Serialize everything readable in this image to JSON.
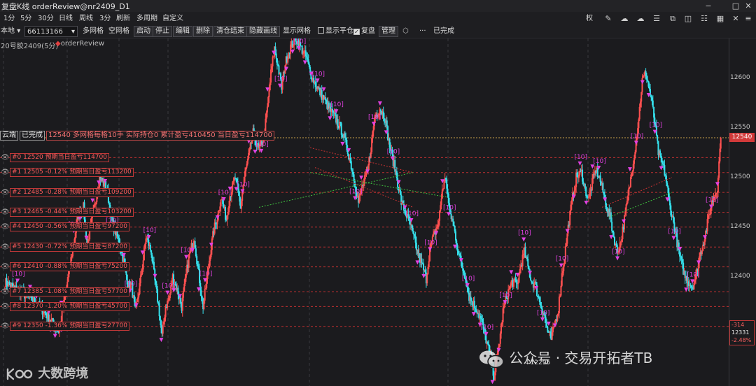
{
  "window": {
    "title": "复盘K线 orderReview@nr2409_D1",
    "controls": [
      "restore-down",
      "maximize",
      "close"
    ]
  },
  "toolbar1": {
    "periods": [
      "1分",
      "5分",
      "30分",
      "日线",
      "周线",
      "3分"
    ],
    "actions": [
      "刷新",
      "多周期",
      "自定义"
    ],
    "right_label": "权"
  },
  "toolbar2": {
    "source": "本地",
    "account": "66113166",
    "buttons_a": [
      "多网格",
      "空网格"
    ],
    "buttons_b": [
      "启动",
      "停止",
      "编辑",
      "删除",
      "清仓结束",
      "隐藏画线"
    ],
    "show_grid": "显示网格",
    "show_flat": "显示平仓",
    "show_flat_checked": false,
    "review": "复盘",
    "review_checked": true,
    "manage": "管理",
    "more": "···",
    "done": "已完成"
  },
  "chart_header": {
    "symbol": "20号胶2409(5分)",
    "indicator": "orderReview"
  },
  "status": {
    "mode": "云端",
    "state": "已完成",
    "info": "12540 多网格每格10手 实际持仓0 累计盈亏410450 当日盈亏114700"
  },
  "grid_levels": [
    {
      "label": "#0 12520 预期当日盈亏114700",
      "price": 12520
    },
    {
      "label": "#1 12505 -0.12% 预期当日盈亏113200",
      "price": 12505
    },
    {
      "label": "#2 12485 -0.28% 预期当日盈亏109200",
      "price": 12485
    },
    {
      "label": "#3 12465 -0.44% 预期当日盈亏103200",
      "price": 12465
    },
    {
      "label": "#4 12450 -0.56% 预期当日盈亏97200",
      "price": 12450
    },
    {
      "label": "#5 12430 -0.72% 预期当日盈亏87200",
      "price": 12430
    },
    {
      "label": "#6 12410 -0.88% 预期当日盈亏75200",
      "price": 12410
    },
    {
      "label": "#7 12385 -1.08% 预期当日盈亏57700",
      "price": 12385
    },
    {
      "label": "#8 12370 -1.20% 预期当日盈亏45700",
      "price": 12370
    },
    {
      "label": "#9 12350 -1.36% 预期当日盈亏27700",
      "price": 12350
    }
  ],
  "price_axis": {
    "ticks": [
      "12600",
      "12550",
      "12500",
      "12450",
      "12400",
      "12350"
    ],
    "current": "12540",
    "change": "-314",
    "last": "12331",
    "change_pct": "-2.48%"
  },
  "annotations": {
    "low_price": "12295"
  },
  "watermarks": {
    "left": "大数跨境",
    "right": "公众号 · 交易开拓者TB"
  },
  "chart_data": {
    "type": "candlestick",
    "yrange": [
      12290,
      12640
    ],
    "ticks": [
      12600,
      12550,
      12500,
      12450,
      12400,
      12350
    ],
    "grid_prices": [
      12520,
      12505,
      12485,
      12465,
      12450,
      12430,
      12410,
      12385,
      12370,
      12350
    ],
    "current_price": 12540,
    "low": 12295,
    "up_color": "#ff5050",
    "down_color": "#35e0ec",
    "marker_color": "#e040e0",
    "trade_label": "[10]",
    "path": [
      [
        12395,
        34
      ],
      [
        12375,
        16
      ],
      [
        12358,
        10
      ],
      [
        12345,
        4
      ],
      [
        12362,
        6
      ],
      [
        12395,
        8
      ],
      [
        12440,
        4
      ],
      [
        12462,
        6
      ],
      [
        12470,
        4
      ],
      [
        12432,
        6
      ],
      [
        12460,
        8
      ],
      [
        12500,
        8
      ],
      [
        12490,
        6
      ],
      [
        12455,
        8
      ],
      [
        12435,
        6
      ],
      [
        12412,
        4
      ],
      [
        12392,
        4
      ],
      [
        12390,
        4
      ],
      [
        12365,
        4
      ],
      [
        12385,
        4
      ],
      [
        12410,
        4
      ],
      [
        12440,
        6
      ],
      [
        12425,
        4
      ],
      [
        12395,
        4
      ],
      [
        12372,
        4
      ],
      [
        12340,
        4
      ],
      [
        12370,
        4
      ],
      [
        12378,
        4
      ],
      [
        12400,
        6
      ],
      [
        12384,
        4
      ],
      [
        12370,
        4
      ],
      [
        12395,
        4
      ],
      [
        12420,
        6
      ],
      [
        12440,
        4
      ],
      [
        12410,
        6
      ],
      [
        12370,
        4
      ],
      [
        12396,
        4
      ],
      [
        12424,
        4
      ],
      [
        12447,
        4
      ],
      [
        12460,
        4
      ],
      [
        12480,
        6
      ],
      [
        12458,
        4
      ],
      [
        12482,
        6
      ],
      [
        12500,
        6
      ],
      [
        12470,
        4
      ],
      [
        12500,
        6
      ],
      [
        12525,
        4
      ],
      [
        12545,
        6
      ],
      [
        12528,
        6
      ],
      [
        12540,
        4
      ],
      [
        12570,
        4
      ],
      [
        12605,
        4
      ],
      [
        12630,
        4
      ],
      [
        12612,
        4
      ],
      [
        12590,
        4
      ],
      [
        12615,
        6
      ],
      [
        12632,
        6
      ],
      [
        12640,
        6
      ],
      [
        12630,
        6
      ],
      [
        12620,
        4
      ],
      [
        12605,
        8
      ],
      [
        12590,
        8
      ],
      [
        12578,
        6
      ],
      [
        12568,
        6
      ],
      [
        12560,
        6
      ],
      [
        12550,
        4
      ],
      [
        12540,
        6
      ],
      [
        12520,
        6
      ],
      [
        12495,
        4
      ],
      [
        12475,
        4
      ],
      [
        12490,
        6
      ],
      [
        12505,
        4
      ],
      [
        12530,
        4
      ],
      [
        12560,
        6
      ],
      [
        12570,
        6
      ],
      [
        12560,
        4
      ],
      [
        12536,
        4
      ],
      [
        12520,
        4
      ],
      [
        12505,
        6
      ],
      [
        12475,
        6
      ],
      [
        12462,
        4
      ],
      [
        12452,
        4
      ],
      [
        12440,
        4
      ],
      [
        12425,
        6
      ],
      [
        12410,
        4
      ],
      [
        12398,
        4
      ],
      [
        12428,
        4
      ],
      [
        12440,
        6
      ],
      [
        12456,
        4
      ],
      [
        12488,
        4
      ],
      [
        12500,
        4
      ],
      [
        12465,
        4
      ],
      [
        12455,
        6
      ],
      [
        12425,
        4
      ],
      [
        12410,
        4
      ],
      [
        12400,
        4
      ],
      [
        12380,
        8
      ],
      [
        12368,
        6
      ],
      [
        12355,
        4
      ],
      [
        12340,
        6
      ],
      [
        12320,
        4
      ],
      [
        12300,
        6
      ],
      [
        12335,
        4
      ],
      [
        12365,
        4
      ],
      [
        12380,
        6
      ],
      [
        12395,
        6
      ],
      [
        12392,
        4
      ],
      [
        12412,
        4
      ],
      [
        12425,
        4
      ],
      [
        12410,
        4
      ],
      [
        12395,
        4
      ],
      [
        12392,
        4
      ],
      [
        12378,
        6
      ],
      [
        12362,
        4
      ],
      [
        12345,
        4
      ],
      [
        12337,
        4
      ],
      [
        12352,
        4
      ],
      [
        12368,
        4
      ],
      [
        12402,
        4
      ],
      [
        12428,
        4
      ],
      [
        12457,
        4
      ],
      [
        12480,
        4
      ],
      [
        12500,
        6
      ],
      [
        12505,
        4
      ],
      [
        12488,
        4
      ],
      [
        12478,
        4
      ],
      [
        12495,
        4
      ],
      [
        12508,
        4
      ],
      [
        12500,
        4
      ],
      [
        12486,
        4
      ],
      [
        12470,
        4
      ],
      [
        12460,
        4
      ],
      [
        12440,
        4
      ],
      [
        12425,
        4
      ],
      [
        12436,
        4
      ],
      [
        12458,
        4
      ],
      [
        12480,
        4
      ],
      [
        12505,
        4
      ],
      [
        12530,
        4
      ],
      [
        12560,
        4
      ],
      [
        12598,
        4
      ],
      [
        12605,
        6
      ],
      [
        12580,
        4
      ],
      [
        12555,
        4
      ],
      [
        12525,
        4
      ],
      [
        12515,
        4
      ],
      [
        12502,
        4
      ],
      [
        12475,
        6
      ],
      [
        12450,
        6
      ],
      [
        12420,
        6
      ],
      [
        12400,
        4
      ],
      [
        12395,
        4
      ],
      [
        12390,
        4
      ],
      [
        12400,
        4
      ],
      [
        12420,
        6
      ],
      [
        12440,
        4
      ],
      [
        12458,
        4
      ],
      [
        12475,
        6
      ],
      [
        12490,
        4
      ],
      [
        12540,
        4
      ]
    ]
  }
}
